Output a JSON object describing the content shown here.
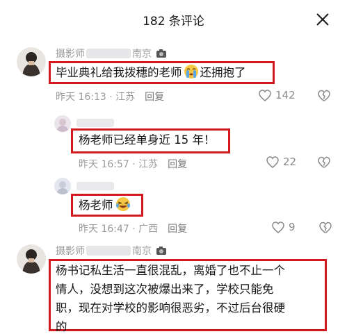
{
  "header": {
    "title": "182 条评论",
    "close_icon": "close-icon"
  },
  "comments": [
    {
      "user_prefix": "摄影师",
      "user_suffix": "南京",
      "text": "毕业典礼给我拨穗的老师",
      "emoji": "crying-face-emoji",
      "text_after": "还拥抱了",
      "time": "昨天 16:13 · 江苏",
      "reply_label": "回复",
      "likes": "142"
    },
    {
      "text": "杨老师已经单身近 15 年！",
      "time": "昨天 16:57 · 江苏",
      "reply_label": "回复",
      "likes": "22"
    },
    {
      "text": "杨老师",
      "emoji": "laughing-crying-emoji",
      "time": "昨天 16:47 · 广西",
      "reply_label": "回复",
      "likes": "9"
    },
    {
      "user_prefix": "摄影师",
      "user_suffix": "南京",
      "lines": [
        "杨书记私生活一直很混乱，离婚了也不止一个",
        "情人，没想到这次被爆出来了，学校只能免",
        "职，现在对学校的影响很恶劣，不过后台很硬",
        "的"
      ]
    }
  ],
  "colors": {
    "highlight_box": "#d3191f",
    "meta_text": "#9a9a9a"
  }
}
